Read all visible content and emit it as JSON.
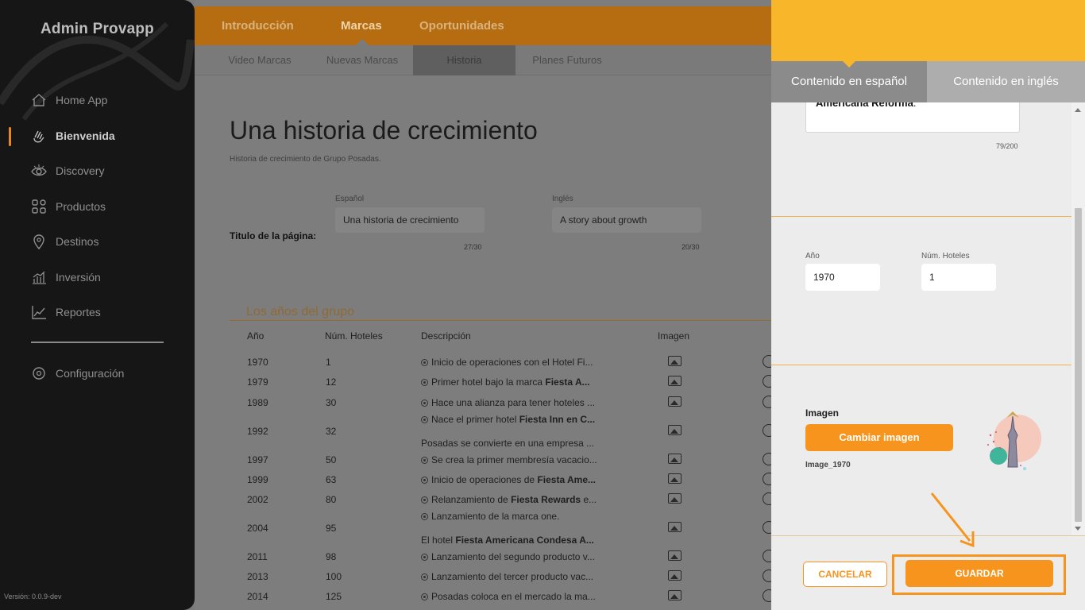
{
  "sidebar": {
    "brand": "Admin Provapp",
    "items": [
      {
        "label": "Home App",
        "icon": "home-icon"
      },
      {
        "label": "Bienvenida",
        "icon": "wave-hand-icon",
        "active": true
      },
      {
        "label": "Discovery",
        "icon": "eye-icon"
      },
      {
        "label": "Productos",
        "icon": "grid-icon"
      },
      {
        "label": "Destinos",
        "icon": "map-pin-icon"
      },
      {
        "label": "Inversión",
        "icon": "bar-chart-icon"
      },
      {
        "label": "Reportes",
        "icon": "line-chart-icon"
      }
    ],
    "config_label": "Configuración",
    "version": "Versión: 0.0.9-dev"
  },
  "topnav": {
    "tabs": [
      "Introducción",
      "Marcas",
      "Oportunidades"
    ],
    "active": "Marcas"
  },
  "subnav": {
    "tabs": [
      "Video Marcas",
      "Nuevas Marcas",
      "Historia",
      "Planes Futuros"
    ],
    "active": "Historia"
  },
  "page": {
    "title": "Una historia de crecimiento",
    "subtitle": "Historia de crecimiento de Grupo Posadas.",
    "field_label": "Titulo de la página:",
    "es_label": "Español",
    "en_label": "Inglés",
    "es_value": "Una historia de crecimiento",
    "en_value": "A story about growth",
    "es_count": "27/30",
    "en_count": "20/30"
  },
  "table": {
    "section_title": "Los años del grupo",
    "headers": [
      "Año",
      "Núm. Hoteles",
      "Descripción",
      "Imagen"
    ],
    "rows": [
      {
        "year": "1970",
        "hotels": "1",
        "desc": "Inicio de operaciones con el Hotel Fi..."
      },
      {
        "year": "1979",
        "hotels": "12",
        "desc_pre": "Primer hotel bajo la marca ",
        "desc_bold": "Fiesta A..."
      },
      {
        "year": "1989",
        "hotels": "30",
        "desc": "Hace una alianza para tener hoteles ..."
      },
      {
        "year": "1992",
        "hotels": "32",
        "desc_pre": "Nace el primer hotel ",
        "desc_bold": "Fiesta Inn en C...",
        "desc2": "Posadas se convierte en una empresa ..."
      },
      {
        "year": "1997",
        "hotels": "50",
        "desc": "Se crea la primer membresía vacacio..."
      },
      {
        "year": "1999",
        "hotels": "63",
        "desc_pre": "Inicio de operaciones de ",
        "desc_bold": "Fiesta Ame..."
      },
      {
        "year": "2002",
        "hotels": "80",
        "desc_pre": "Relanzamiento de ",
        "desc_bold": "Fiesta Rewards",
        "desc_post": " e..."
      },
      {
        "year": "2004",
        "hotels": "95",
        "desc": "Lanzamiento de la marca one.",
        "desc2_pre": "El hotel ",
        "desc2_bold": "Fiesta Americana Condesa A..."
      },
      {
        "year": "2011",
        "hotels": "98",
        "desc": "Lanzamiento del segundo producto v..."
      },
      {
        "year": "2013",
        "hotels": "100",
        "desc": "Lanzamiento del tercer producto vac..."
      },
      {
        "year": "2014",
        "hotels": "125",
        "desc": "Posadas coloca en el mercado la ma..."
      }
    ]
  },
  "panel": {
    "tab_es": "Contenido en español",
    "tab_en": "Contenido en inglés",
    "textarea_bold": "Americana Reforma",
    "textarea_post": ".",
    "textarea_count": "79/200",
    "year_label": "Año",
    "year_value": "1970",
    "hotels_label": "Núm. Hoteles",
    "hotels_value": "1",
    "image_label": "Imagen",
    "change_image": "Cambiar imagen",
    "image_name": "Image_1970",
    "cancel": "CANCELAR",
    "save": "GUARDAR"
  },
  "colors": {
    "accent": "#f7941d",
    "panel_header": "#f8b62b",
    "sidebar_bg": "#161616"
  }
}
